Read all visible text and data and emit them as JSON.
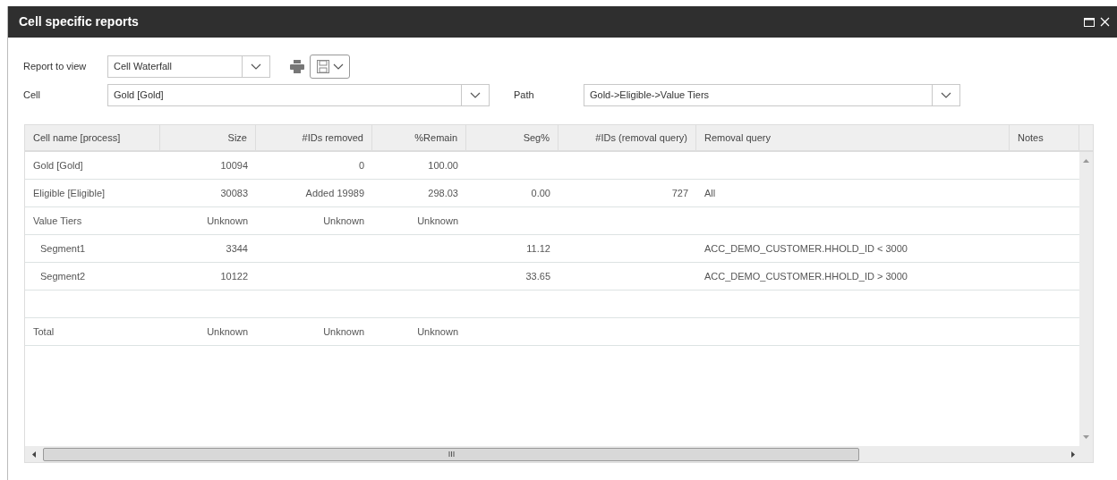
{
  "window": {
    "title": "Cell specific reports"
  },
  "report": {
    "label": "Report to view",
    "value": "Cell Waterfall"
  },
  "cell": {
    "label": "Cell",
    "value": "Gold [Gold]"
  },
  "path": {
    "label": "Path",
    "value": "Gold->Eligible->Value Tiers"
  },
  "table": {
    "columns": [
      "Cell name [process]",
      "Size",
      "#IDs removed",
      "%Remain",
      "Seg%",
      "#IDs (removal query)",
      "Removal query",
      "Notes"
    ],
    "rows": [
      {
        "kind": "data",
        "name": "Gold [Gold]",
        "size": "10094",
        "removed": "0",
        "remain": "100.00"
      },
      {
        "kind": "data",
        "name": "Eligible [Eligible]",
        "size": "30083",
        "removed": "Added 19989",
        "remain": "298.03",
        "seg": "0.00",
        "ids": "727",
        "query": "All"
      },
      {
        "kind": "data",
        "name": "Value Tiers",
        "size": "Unknown",
        "removed": "Unknown",
        "remain": "Unknown",
        "children": [
          {
            "kind": "data",
            "name": "Segment1",
            "size": "3344",
            "seg": "11.12",
            "query": "ACC_DEMO_CUSTOMER.HHOLD_ID < 3000"
          },
          {
            "kind": "data",
            "name": "Segment2",
            "size": "10122",
            "seg": "33.65",
            "query": "ACC_DEMO_CUSTOMER.HHOLD_ID > 3000"
          }
        ]
      },
      {
        "kind": "spacer"
      },
      {
        "kind": "data",
        "name": "Total",
        "size": "Unknown",
        "removed": "Unknown",
        "remain": "Unknown"
      }
    ]
  }
}
